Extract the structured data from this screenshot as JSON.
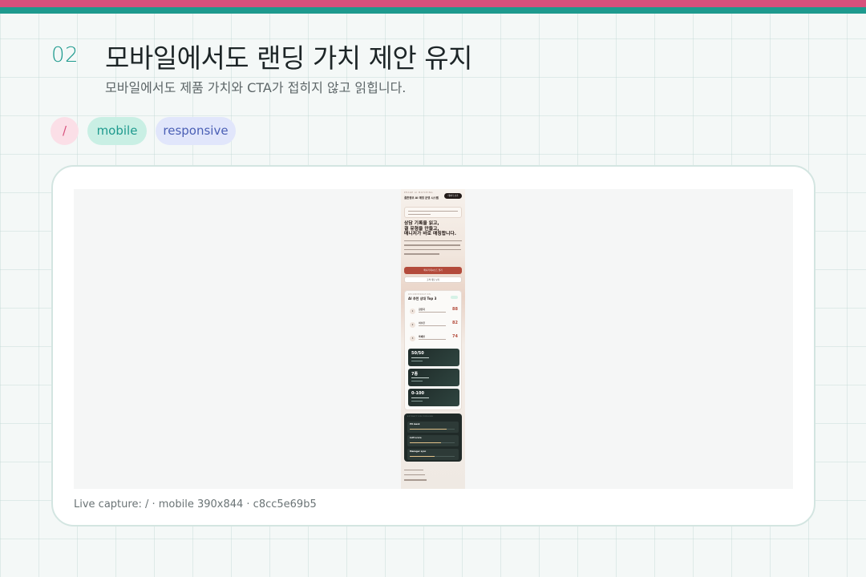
{
  "slide": {
    "number": "02",
    "title": "모바일에서도 랜딩 가치 제안 유지",
    "subtitle": "모바일에서도 제품 가치와 CTA가 접히지 않고 읽힙니다."
  },
  "tags": [
    {
      "label": "/",
      "color": "#d8507c"
    },
    {
      "label": "mobile",
      "color": "#1e9a8e"
    },
    {
      "label": "responsive",
      "color": "#4a5fb5"
    }
  ],
  "accent_colors": {
    "pink": "#d8507c",
    "teal": "#1e9a8e"
  },
  "capture": {
    "caption": "Live capture: / · mobile 390x844 · c8cc5e69b5",
    "mobile": {
      "kicker": "PHAGE AI MATCHING",
      "brand": "결혼정보 AI 매칭 운영 시스템",
      "top_button": "데이터 보기",
      "hero_lines": [
        "상담 기록을 읽고,",
        "결 유형을 만들고,",
        "매니저가 바로 매칭합니다."
      ],
      "primary_cta": "매니저 대시보드 열기",
      "secondary_cta": "고객 데모 보기",
      "panel_kicker": "RECOMMENDATION",
      "panel_title": "AI 추천 상대 Top 3",
      "recommendations": [
        {
          "rank": "1",
          "name": "김민지",
          "score": "88"
        },
        {
          "rank": "2",
          "name": "이수진",
          "score": "82"
        },
        {
          "rank": "3",
          "name": "박채영",
          "score": "74"
        }
      ],
      "stats": [
        {
          "value": "50/50"
        },
        {
          "value": "7종"
        },
        {
          "value": "0-100"
        }
      ],
      "dark_kicker": "EXTRACTION PIPELINE",
      "pipeline": [
        {
          "label": "PII mask",
          "level": 0.82
        },
        {
          "label": "LLM score",
          "level": 0.7
        },
        {
          "label": "Manager sync",
          "level": 0.55
        }
      ]
    }
  }
}
